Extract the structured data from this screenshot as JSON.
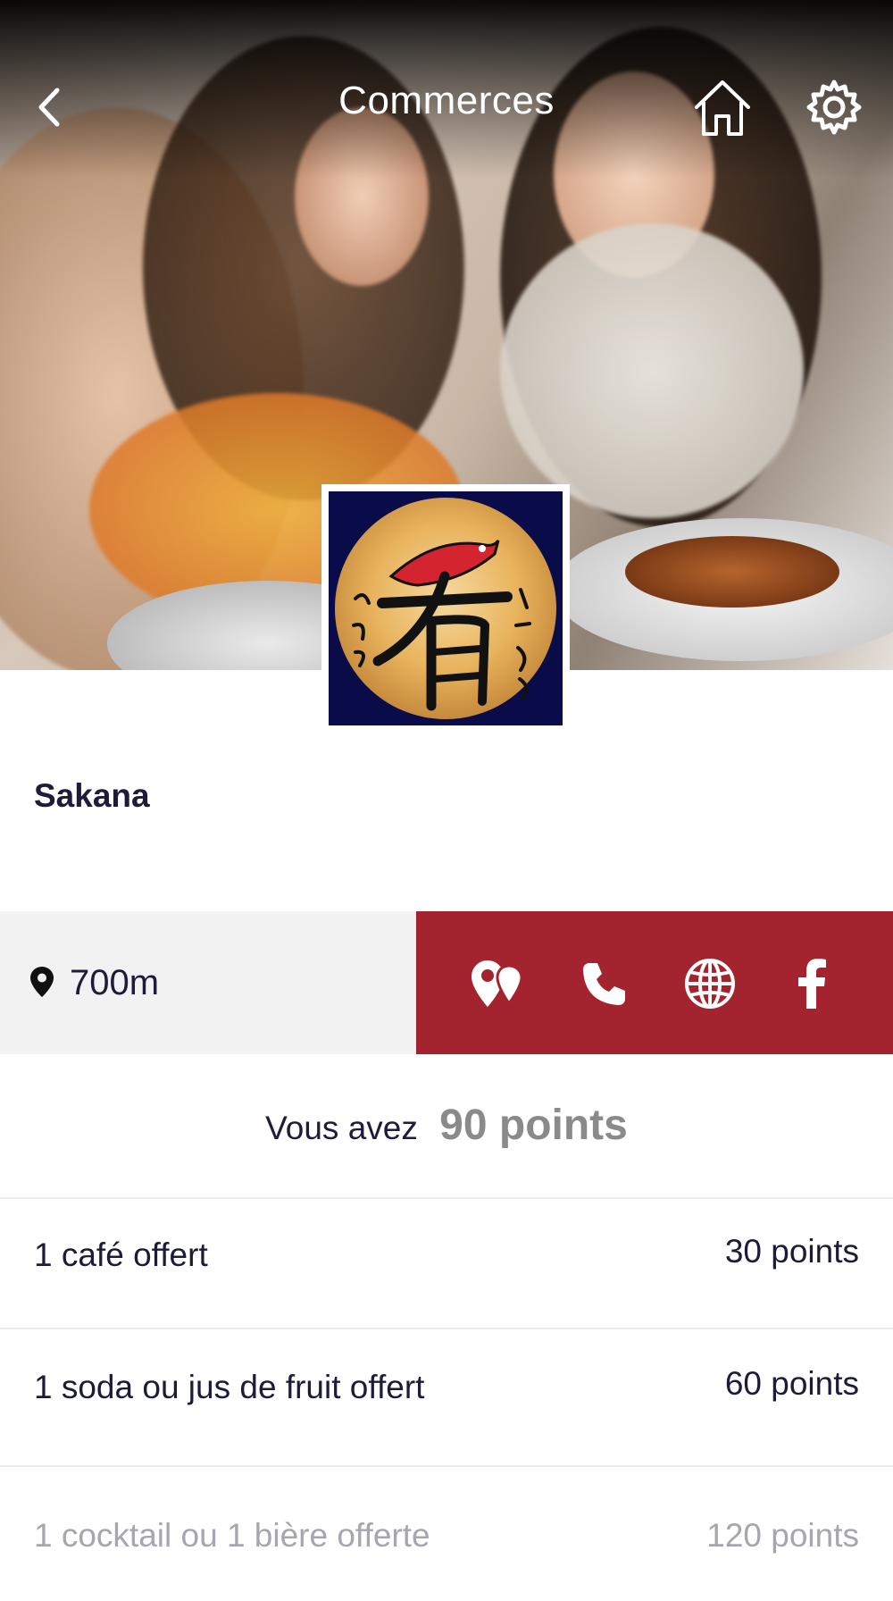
{
  "header": {
    "title": "Commerces"
  },
  "shop": {
    "name": "Sakana",
    "distance": "700m"
  },
  "points": {
    "prefix": "Vous avez",
    "value": "90 points"
  },
  "rewards": [
    {
      "label": "1 café offert",
      "cost": "30 points",
      "available": true
    },
    {
      "label": "1 soda ou jus de fruit offert",
      "cost": "60 points",
      "available": true
    },
    {
      "label": "1 cocktail ou 1 bière offerte",
      "cost": "120 points",
      "available": false
    }
  ],
  "colors": {
    "accent": "#a3232f",
    "info_bg": "#f2f2f2",
    "text_dark": "#1e1c3a",
    "text_muted": "#a6a6b0"
  },
  "icons": {
    "back": "chevron-left-icon",
    "home": "home-icon",
    "settings": "gear-icon",
    "location": "map-pin-icon",
    "directions": "map-markers-icon",
    "phone": "phone-icon",
    "website": "globe-icon",
    "facebook": "facebook-icon"
  }
}
